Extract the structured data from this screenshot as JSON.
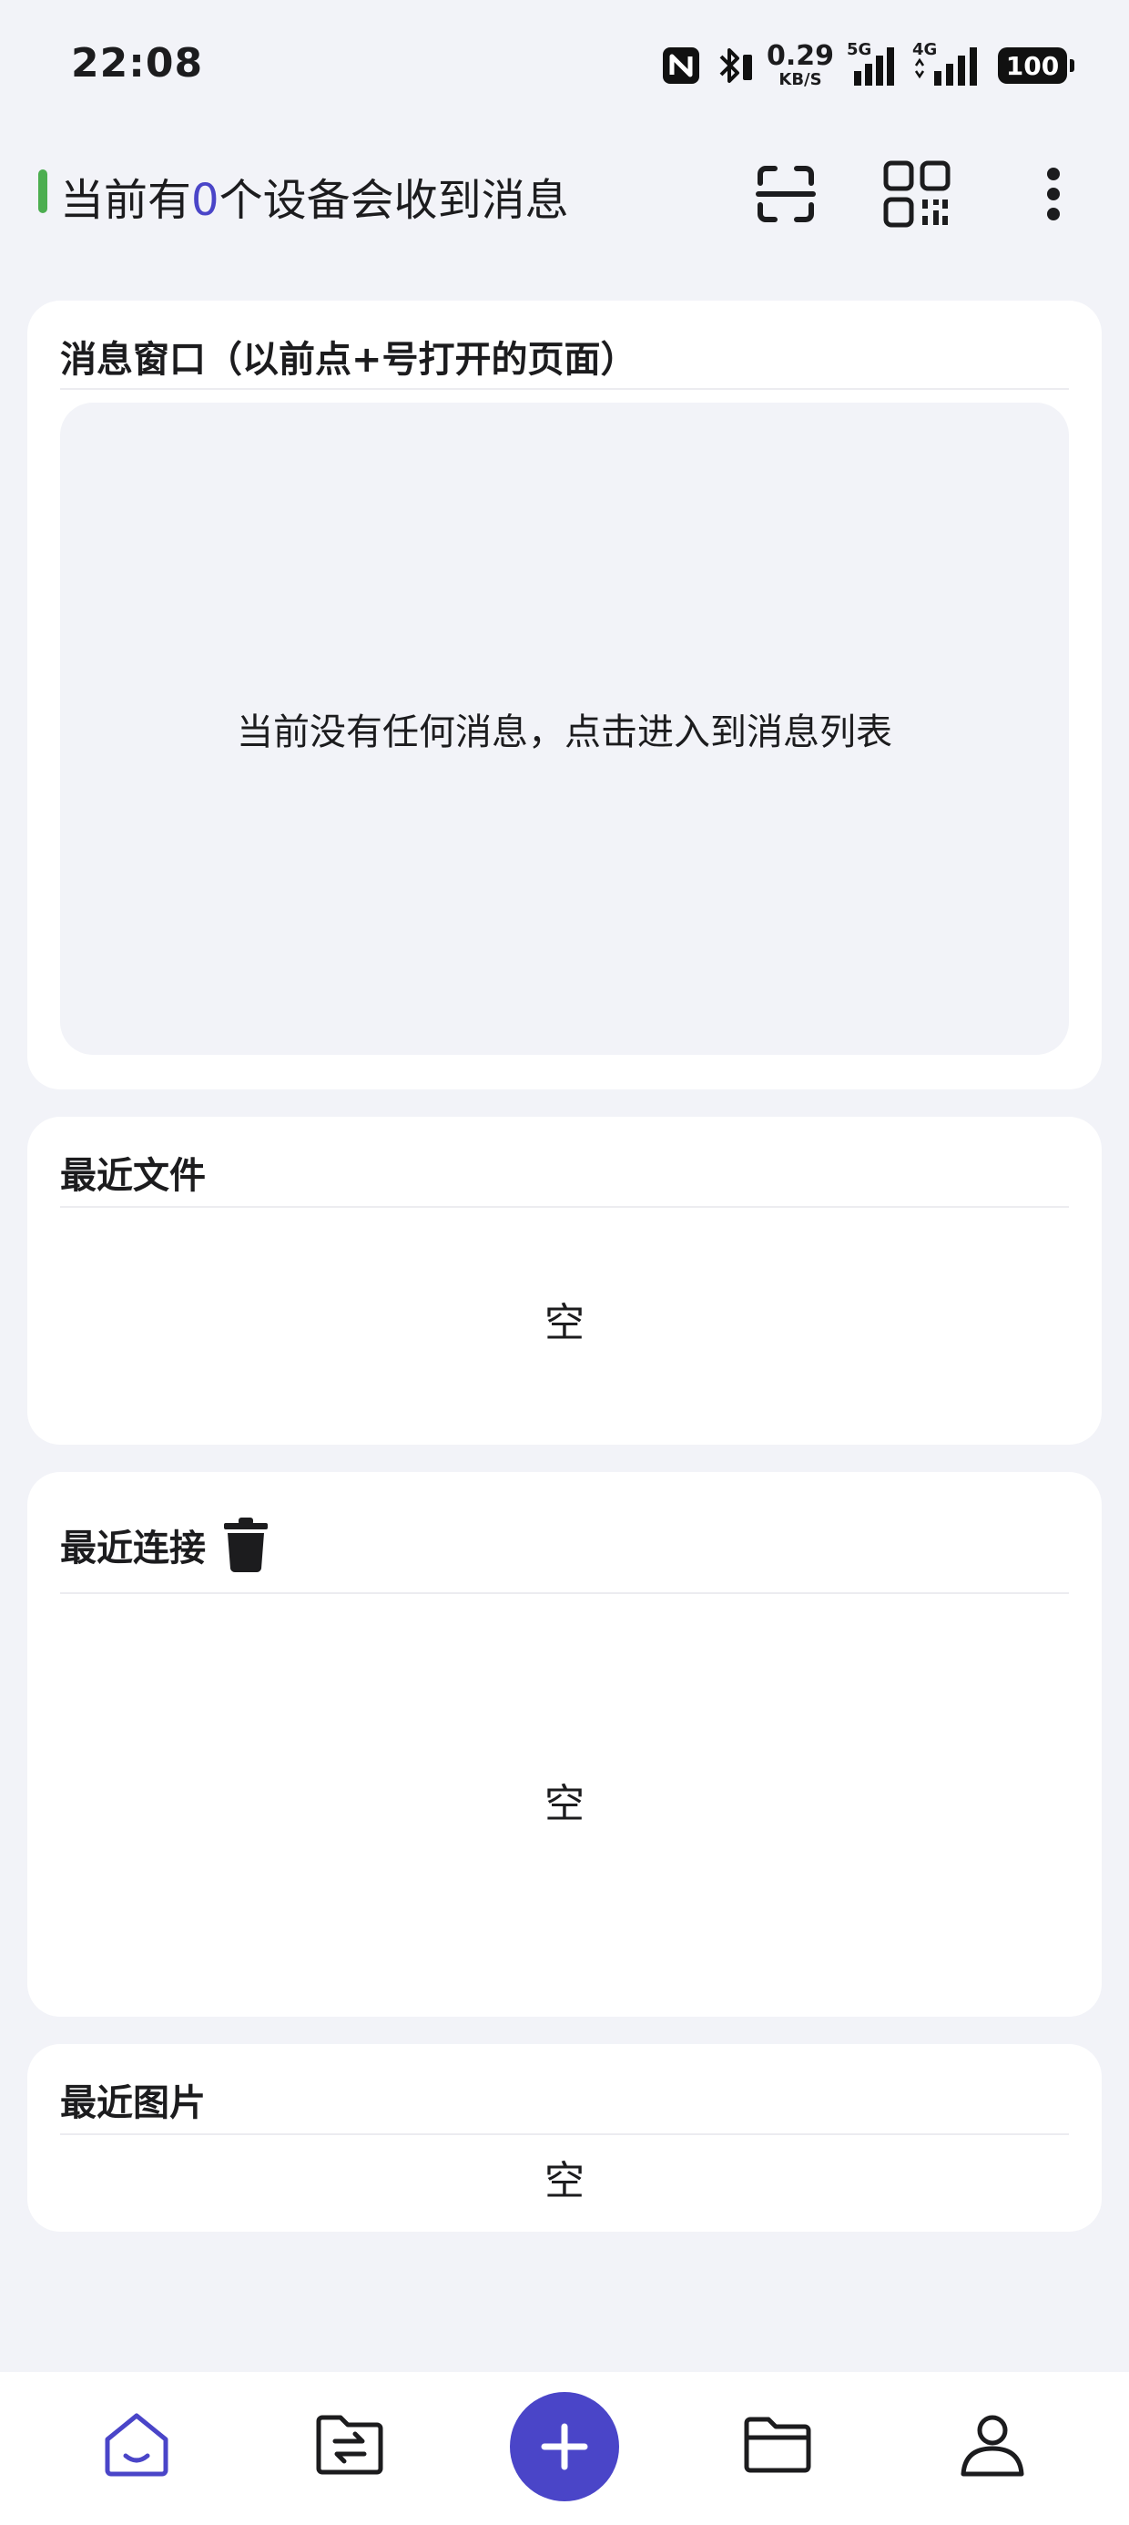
{
  "status_bar": {
    "time": "22:08",
    "net_speed_value": "0.29",
    "net_speed_unit": "KB/S",
    "network_5g": "5G",
    "network_4g": "4G",
    "battery": "100"
  },
  "header": {
    "title_prefix": "当前有",
    "device_count": "0",
    "title_suffix": "个设备会收到消息",
    "accent_color": "#4cae50",
    "count_color": "#4a45c8"
  },
  "message_card": {
    "title": "消息窗口（以前点+号打开的页面）",
    "empty_text": "当前没有任何消息，点击进入到消息列表"
  },
  "recent_files": {
    "title": "最近文件",
    "empty_text": "空"
  },
  "recent_connections": {
    "title": "最近连接",
    "empty_text": "空"
  },
  "recent_images": {
    "title": "最近图片",
    "empty_text": "空"
  },
  "icons": {
    "scan": "scan-icon",
    "qr": "qr-code-icon",
    "more": "more-vertical-icon",
    "trash": "trash-icon",
    "home": "home-icon",
    "transfer": "file-transfer-icon",
    "add": "plus-icon",
    "folder": "folder-icon",
    "profile": "user-icon"
  },
  "colors": {
    "brand": "#4a45c8",
    "background": "#f2f3f8"
  }
}
